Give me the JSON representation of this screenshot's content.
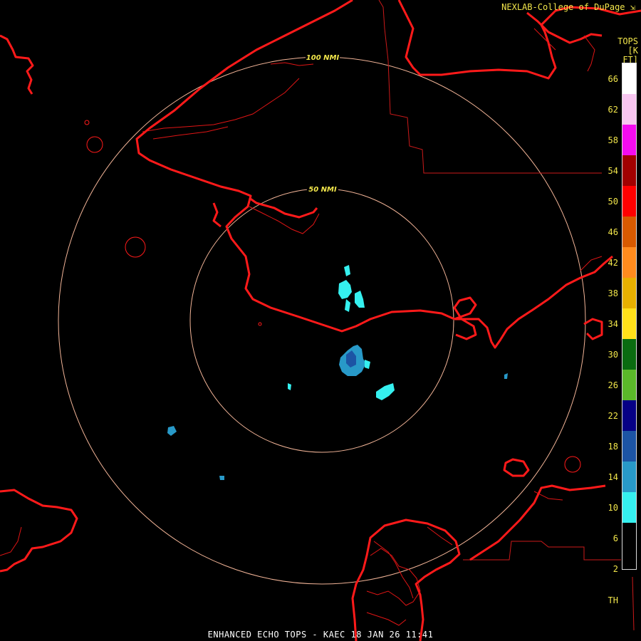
{
  "credit": "NEXLAB-College of DuPage",
  "credit_icon": "diagonal-arrow-icon",
  "legend": {
    "title": "TOPS",
    "unit": "[K FT]",
    "ticks": [
      "66",
      "62",
      "58",
      "54",
      "50",
      "46",
      "42",
      "38",
      "34",
      "30",
      "26",
      "22",
      "18",
      "14",
      "10",
      "6",
      "2",
      "TH"
    ],
    "colors": [
      "#ffffff",
      "#f7c6f0",
      "#f40cf0",
      "#a10000",
      "#ff0000",
      "#d85a00",
      "#ff8b1e",
      "#e8b000",
      "#ffe01a",
      "#0a6b10",
      "#5bb82a",
      "#060085",
      "#1c54a4",
      "#2899c8",
      "#35f0ef",
      "#000000"
    ]
  },
  "rings": [
    {
      "label": "50 NMI"
    },
    {
      "label": "100 NMI"
    }
  ],
  "footer": "ENHANCED ECHO TOPS - KAEC 18 JAN 26 11:41",
  "colors": {
    "coast": "#ff1a1a",
    "border": "#cc1a1a",
    "ring": "#f2b497",
    "text": "#f2e64b"
  },
  "echo_levels": [
    "2",
    "6",
    "10"
  ]
}
